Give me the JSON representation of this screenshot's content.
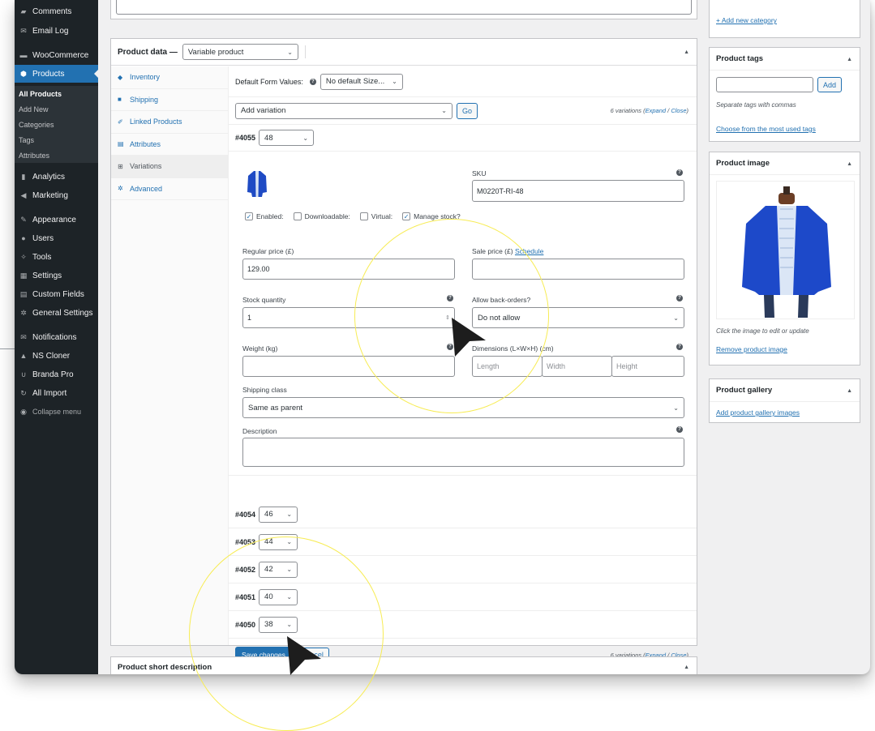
{
  "sidebar": {
    "items": [
      {
        "label": "Comments",
        "icon": "comment-icon"
      },
      {
        "label": "Email Log",
        "icon": "mail-icon"
      },
      {
        "label": "WooCommerce",
        "icon": "woo-icon"
      },
      {
        "label": "Products",
        "icon": "box-icon"
      },
      {
        "label": "Analytics",
        "icon": "bar-chart-icon"
      },
      {
        "label": "Marketing",
        "icon": "megaphone-icon"
      },
      {
        "label": "Appearance",
        "icon": "brush-icon"
      },
      {
        "label": "Users",
        "icon": "user-icon"
      },
      {
        "label": "Tools",
        "icon": "wrench-icon"
      },
      {
        "label": "Settings",
        "icon": "settings-icon"
      },
      {
        "label": "Custom Fields",
        "icon": "fields-icon"
      },
      {
        "label": "General Settings",
        "icon": "gear-icon"
      },
      {
        "label": "Notifications",
        "icon": "mail-icon"
      },
      {
        "label": "NS Cloner",
        "icon": "cloner-icon"
      },
      {
        "label": "Branda Pro",
        "icon": "branda-icon"
      },
      {
        "label": "All Import",
        "icon": "import-icon"
      },
      {
        "label": "Collapse menu",
        "icon": "collapse-icon"
      }
    ],
    "products_sub": [
      "All Products",
      "Add New",
      "Categories",
      "Tags",
      "Attributes"
    ]
  },
  "product_data": {
    "title": "Product data —",
    "type_select": "Variable product",
    "tabs": [
      "Inventory",
      "Shipping",
      "Linked Products",
      "Attributes",
      "Variations",
      "Advanced"
    ],
    "default_form_label": "Default Form Values:",
    "default_form_value": "No default Size...",
    "add_variation": "Add variation",
    "go": "Go",
    "variations_count": "6 variations",
    "expand": "Expand",
    "close": "Close",
    "expanded": {
      "id": "#4055",
      "size": "48",
      "sku_label": "SKU",
      "sku": "M0220T-RI-48",
      "enabled": "Enabled:",
      "downloadable": "Downloadable:",
      "virtual": "Virtual:",
      "manage_stock": "Manage stock?",
      "regular_price_label": "Regular price (£)",
      "regular_price": "129.00",
      "sale_price_label": "Sale price (£)",
      "schedule": "Schedule",
      "stock_qty_label": "Stock quantity",
      "stock_qty": "1",
      "backorders_label": "Allow back-orders?",
      "backorders": "Do not allow",
      "weight_label": "Weight (kg)",
      "dimensions_label": "Dimensions (L×W×H) (cm)",
      "length_ph": "Length",
      "width_ph": "Width",
      "height_ph": "Height",
      "shipping_class_label": "Shipping class",
      "shipping_class": "Same as parent",
      "description_label": "Description"
    },
    "collapsed": [
      {
        "id": "#4054",
        "size": "46"
      },
      {
        "id": "#4053",
        "size": "44"
      },
      {
        "id": "#4052",
        "size": "42"
      },
      {
        "id": "#4051",
        "size": "40"
      },
      {
        "id": "#4050",
        "size": "38"
      }
    ],
    "save": "Save changes",
    "cancel": "Cancel"
  },
  "short_description": {
    "title": "Product short description"
  },
  "right": {
    "add_category": "+ Add new category",
    "tags_title": "Product tags",
    "tags_add": "Add",
    "tags_hint": "Separate tags with commas",
    "tags_choose": "Choose from the most used tags",
    "image_title": "Product image",
    "image_hint": "Click the image to edit or update",
    "image_remove": "Remove product image",
    "gallery_title": "Product gallery",
    "gallery_add": "Add product gallery images"
  },
  "colors": {
    "accent": "#2271b1",
    "sidebar": "#1d2327",
    "highlight": "#f7ec54"
  }
}
